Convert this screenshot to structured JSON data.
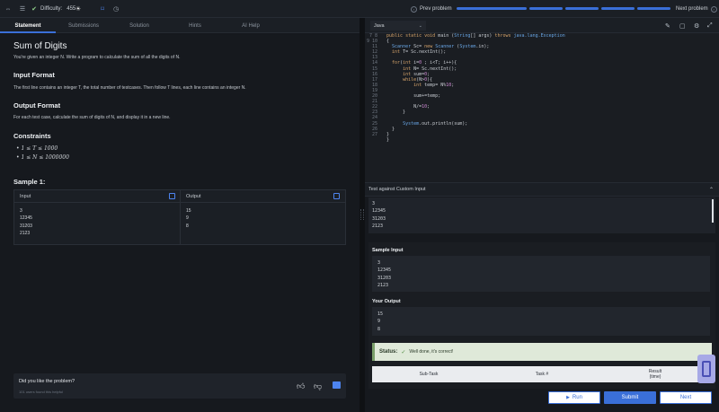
{
  "topbar": {
    "difficulty_label": "Difficulty:",
    "difficulty_value": "455",
    "prev_label": "Prev problem",
    "next_label": "Next problem"
  },
  "left_tabs": [
    "Statement",
    "Submissions",
    "Solution",
    "Hints",
    "AI Help"
  ],
  "statement": {
    "title": "Sum of Digits",
    "intro": "You're given an integer N. Write a program to calculate the sum of all the digits of N.",
    "input_heading": "Input Format",
    "input_text": "The first line contains an integer T, the total number of testcases. Then follow T lines, each line contains an integer N.",
    "output_heading": "Output Format",
    "output_text": "For each test case, calculate the sum of digits of N, and display it in a new line.",
    "constraints_heading": "Constraints",
    "constraints": [
      "1 ≤ T ≤ 1000",
      "1 ≤ N ≤ 1000000"
    ],
    "sample_heading": "Sample 1:",
    "sample_input_label": "Input",
    "sample_output_label": "Output",
    "sample_input": "3\n12345\n31203\n2123",
    "sample_output": "15\n9\n8"
  },
  "feedback": {
    "question": "Did you like the problem?",
    "sub": "101 users found this helpful"
  },
  "editor": {
    "language": "Java",
    "line_numbers": "7\n8\n9\n10\n11\n12\n13\n14\n15\n16\n17\n18\n19\n20\n21\n22\n23\n24\n25\n26\n27",
    "lines": [
      "public static void main (String[] args) throws java.lang.Exception",
      "{",
      "  Scanner Sc= new Scanner (System.in);",
      "  int T= Sc.nextInt();",
      "",
      "  for(int i=0 ; i<T; i++){",
      "      int N= Sc.nextInt();",
      "      int sum=0;",
      "      while(N>0){",
      "          int temp= N%10;",
      "",
      "          sum+=temp;",
      "",
      "          N/=10;",
      "      }",
      "",
      "      System.out.println(sum);",
      "  }",
      "}",
      "}",
      ""
    ]
  },
  "custom_test": {
    "label": "Test against Custom Input",
    "value": "3\n12345\n31203\n2123"
  },
  "results": {
    "sample_input_label": "Sample Input",
    "sample_input": "3\n12345\n31203\n2123",
    "your_output_label": "Your Output",
    "your_output": "15\n9\n8",
    "status_label": "Status:",
    "status_text": "Well done, it's correct!",
    "table_headers": [
      "Sub-Task",
      "Task #",
      "Result\n(time)"
    ]
  },
  "buttons": {
    "run": "Run",
    "submit": "Submit",
    "next": "Next"
  },
  "colors": {
    "accent": "#3a6fd8",
    "success_bg": "#dfe9d9"
  }
}
